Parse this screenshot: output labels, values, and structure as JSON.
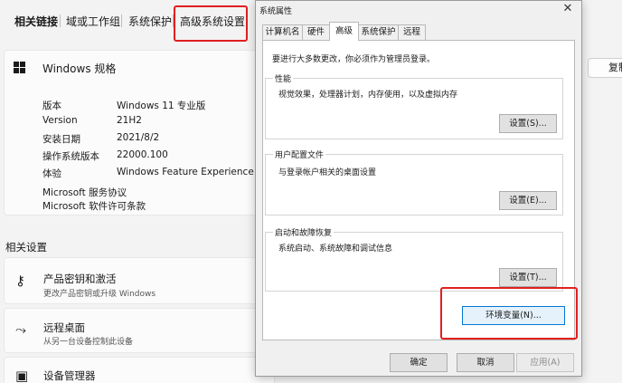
{
  "related_links": {
    "items": [
      "相关链接",
      "域或工作组",
      "系统保护",
      "高级系统设置"
    ]
  },
  "spec": {
    "title": "Windows 规格",
    "rows": [
      {
        "label": "版本",
        "value": "Windows 11 专业版"
      },
      {
        "label": "Version",
        "value": "21H2"
      },
      {
        "label": "安装日期",
        "value": "2021/8/2"
      },
      {
        "label": "操作系统版本",
        "value": "22000.100"
      },
      {
        "label": "体验",
        "value": "Windows Feature Experience Pack"
      }
    ],
    "links": [
      "Microsoft 服务协议",
      "Microsoft 软件许可条款"
    ]
  },
  "right_partial_button": "复制",
  "related_settings": {
    "title": "相关设置",
    "items": [
      {
        "title": "产品密钥和激活",
        "subtitle": "更改产品密钥或升级 Windows",
        "icon": "key-icon"
      },
      {
        "title": "远程桌面",
        "subtitle": "从另一台设备控制此设备",
        "icon": "remote-desktop-icon"
      },
      {
        "title": "设备管理器",
        "subtitle": "",
        "icon": "device-manager-icon"
      }
    ]
  },
  "dialog": {
    "title": "系统属性",
    "close": "✕",
    "tabs": [
      "计算机名",
      "硬件",
      "高级",
      "系统保护",
      "远程"
    ],
    "active_tab": "高级",
    "admin_note": "要进行大多数更改，你必须作为管理员登录。",
    "groups": [
      {
        "title": "性能",
        "desc": "视觉效果，处理器计划，内存使用，以及虚拟内存",
        "button": "设置(S)..."
      },
      {
        "title": "用户配置文件",
        "desc": "与登录帐户相关的桌面设置",
        "button": "设置(E)..."
      },
      {
        "title": "启动和故障恢复",
        "desc": "系统启动、系统故障和调试信息",
        "button": "设置(T)..."
      }
    ],
    "env_button": "环境变量(N)...",
    "ok": "确定",
    "cancel": "取消",
    "apply": "应用(A)"
  },
  "colors": {
    "highlight_border": "#e02020",
    "focus_border": "#0078d7"
  }
}
